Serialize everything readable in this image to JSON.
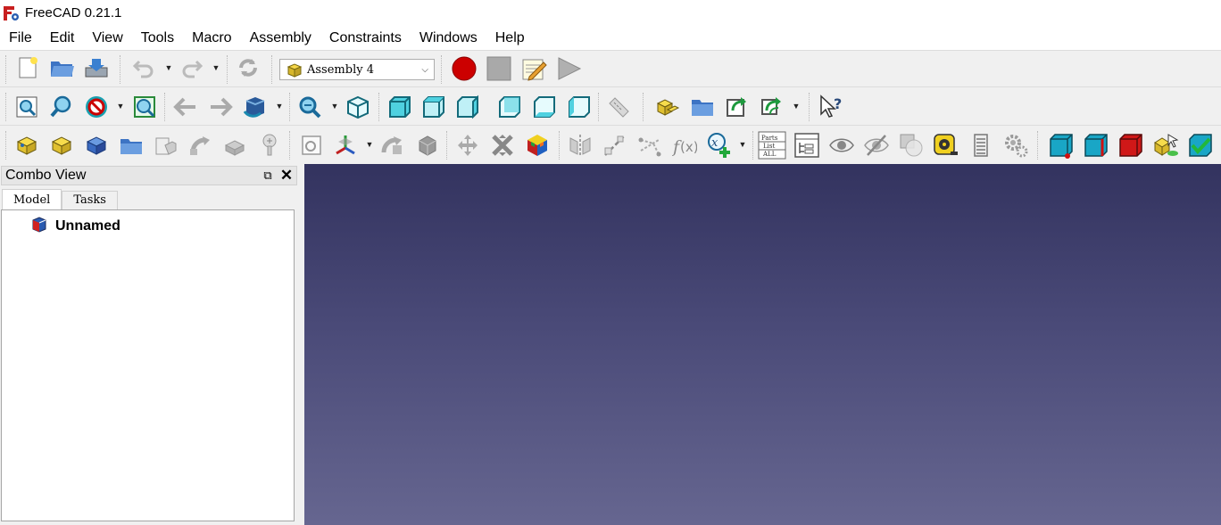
{
  "window": {
    "title": "FreeCAD 0.21.1"
  },
  "menu": [
    "File",
    "Edit",
    "View",
    "Tools",
    "Macro",
    "Assembly",
    "Constraints",
    "Windows",
    "Help"
  ],
  "workbench_selector": {
    "selected": "Assembly 4"
  },
  "combo_view": {
    "title": "Combo View",
    "tabs": [
      "Model",
      "Tasks"
    ],
    "active_tab": "Model",
    "tree": [
      {
        "label": "Unnamed"
      }
    ]
  },
  "toolbar1_icons": [
    "new-document-icon",
    "open-document-icon",
    "save-document-icon",
    "undo-icon",
    "redo-icon",
    "refresh-icon",
    "record-macro-icon",
    "stop-macro-icon",
    "edit-macro-icon",
    "run-macro-icon"
  ],
  "toolbar2_icons": [
    "fit-all-icon",
    "fit-selection-icon",
    "draw-style-icon",
    "bounding-box-icon",
    "back-icon",
    "forward-icon",
    "sync-view-icon",
    "zoom-icon",
    "isometric-view-icon",
    "front-view-icon",
    "top-view-icon",
    "right-view-icon",
    "rear-view-icon",
    "bottom-view-icon",
    "left-view-icon",
    "measure-icon",
    "create-part-icon",
    "create-group-icon",
    "link-icon",
    "link-actions-icon",
    "whats-this-icon"
  ],
  "toolbar3_icons": [
    "new-model-icon",
    "new-part-icon",
    "new-body-icon",
    "new-group-icon",
    "new-sketch-icon",
    "new-lcs-icon",
    "insert-link-icon",
    "import-datum-icon",
    "fastener-icon",
    "variant-link-icon",
    "datum-object-icon",
    "mirror-part-icon",
    "place-link-icon",
    "rotate-icon",
    "explode-icon",
    "solver-icon",
    "mirror-icon",
    "datum-line-icon",
    "datum-plane-icon",
    "expression-icon",
    "variables-icon",
    "parts-list-icon",
    "bom-icon",
    "show-icon",
    "hide-icon",
    "transparency-icon",
    "measure-tape-icon",
    "animation-icon",
    "settings-icon",
    "cube-vertex-icon",
    "cube-edge-icon",
    "cube-face-icon",
    "select-solid-icon",
    "check-icon"
  ],
  "colors": {
    "viewport_top": "#33335f",
    "viewport_bottom": "#666690",
    "record": "#cc0000"
  }
}
